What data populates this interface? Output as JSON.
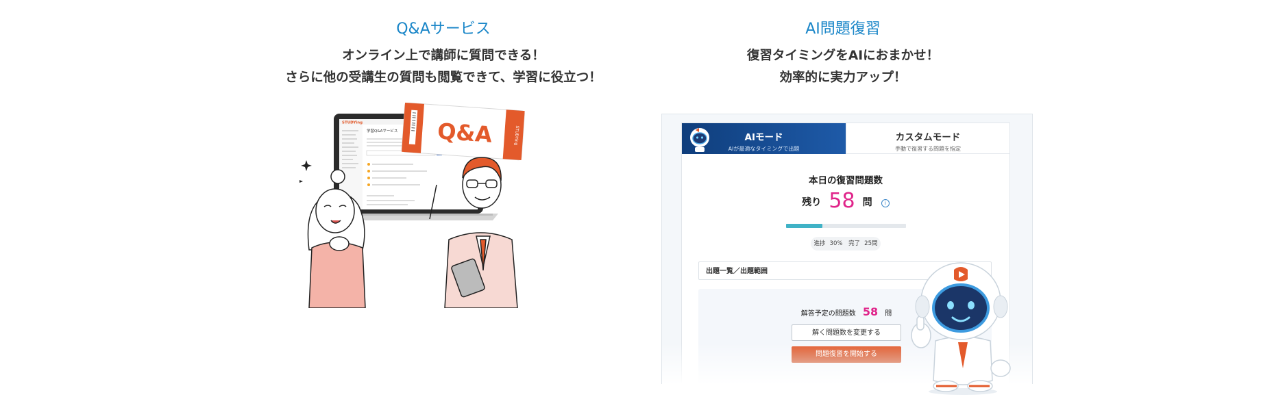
{
  "qa_section": {
    "title": "Q&Aサービス",
    "desc_line1": "オンライン上で講師に質問できる！",
    "desc_line2": "さらに他の受講生の質問も閲覧できて、学習に役立つ！",
    "ticket_text": "Q&A",
    "ticket_side_text": "STUDYing",
    "laptop_page_title": "学習Q&Aサービス",
    "laptop_logo": "STUDYing"
  },
  "ai_section": {
    "title": "AI問題復習",
    "desc_line1": "復習タイミングをAIにおまかせ！",
    "desc_line2": "効率的に実力アップ！",
    "app": {
      "tabs": [
        {
          "label": "AIモード",
          "sub": "AIが最適なタイミングで出題",
          "active": true
        },
        {
          "label": "カスタムモード",
          "sub": "手動で復習する問題を指定",
          "active": false
        }
      ],
      "today_title": "本日の復習問題数",
      "remain_label": "残り",
      "remain_count": "58",
      "remain_unit": "問",
      "info_icon_char": "i",
      "progress": {
        "percent": 30,
        "label": "進捗",
        "percent_text": "30%",
        "done_label": "完了",
        "done_text": "25問"
      },
      "range_label": "出題一覧／出題範囲",
      "planned_label": "解答予定の問題数",
      "planned_count": "58",
      "planned_unit": "問",
      "change_button": "解く問題数を変更する",
      "start_button": "問題復習を開始する"
    }
  },
  "colors": {
    "title_blue": "#1a86c8",
    "accent_pink": "#e0248a",
    "accent_orange": "#e35a2b",
    "progress_teal": "#3fb2c6",
    "tab_navy": "#12417f"
  }
}
